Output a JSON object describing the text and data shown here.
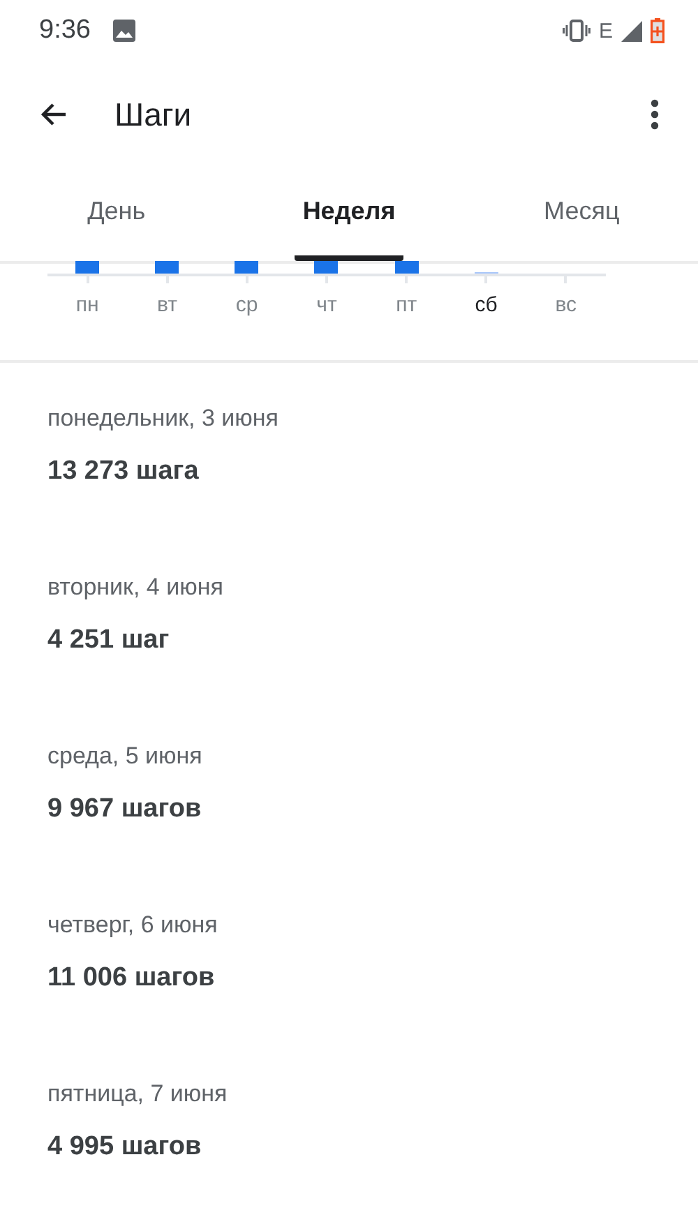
{
  "status_bar": {
    "time": "9:36",
    "network": "E"
  },
  "app_bar": {
    "title": "Шаги"
  },
  "tabs": [
    {
      "label": "День",
      "selected": false
    },
    {
      "label": "Неделя",
      "selected": true
    },
    {
      "label": "Месяц",
      "selected": false
    }
  ],
  "chart_days": [
    {
      "label": "пн",
      "kind": "bar",
      "selected": false
    },
    {
      "label": "вт",
      "kind": "bar",
      "selected": false
    },
    {
      "label": "ср",
      "kind": "bar",
      "selected": false
    },
    {
      "label": "чт",
      "kind": "bar",
      "selected": false
    },
    {
      "label": "пт",
      "kind": "bar",
      "selected": false
    },
    {
      "label": "сб",
      "kind": "faint",
      "selected": true
    },
    {
      "label": "вс",
      "kind": "empty",
      "selected": false
    }
  ],
  "days": [
    {
      "date": "понедельник, 3 июня",
      "steps": "13 273 шага"
    },
    {
      "date": "вторник, 4 июня",
      "steps": "4 251 шаг"
    },
    {
      "date": "среда, 5 июня",
      "steps": "9 967 шагов"
    },
    {
      "date": "четверг, 6 июня",
      "steps": "11 006 шагов"
    },
    {
      "date": "пятница, 7 июня",
      "steps": "4 995 шагов"
    }
  ]
}
